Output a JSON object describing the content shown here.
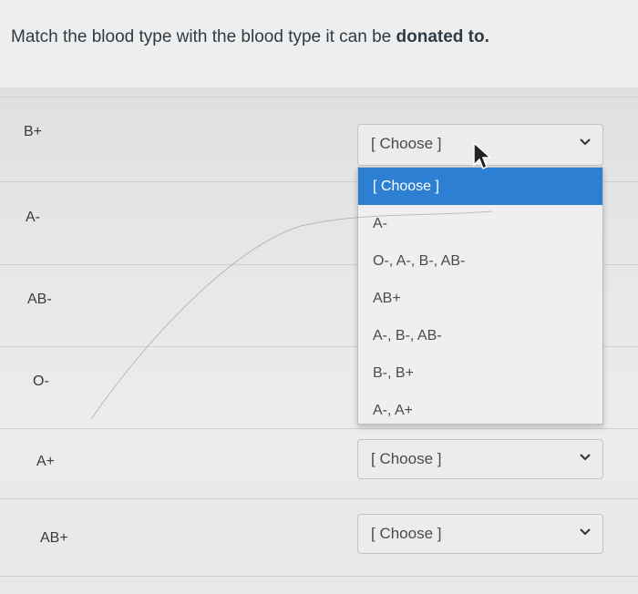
{
  "question": {
    "text_plain": "Match the blood type with the blood type it can be ",
    "text_bold": "donated to."
  },
  "rows": [
    {
      "label": "B+",
      "selected": "[ Choose ]"
    },
    {
      "label": "A-"
    },
    {
      "label": "AB-"
    },
    {
      "label": "O-"
    },
    {
      "label": "A+",
      "selected": "[ Choose ]"
    },
    {
      "label": "AB+",
      "selected": "[ Choose ]"
    }
  ],
  "dropdown": {
    "options": [
      "[ Choose ]",
      "A-",
      "O-, A-, B-, AB-",
      "AB+",
      "A-, B-, AB-",
      "B-, B+",
      "A-, A+"
    ],
    "highlighted_index": 0
  },
  "colors": {
    "highlight": "#2d7fd3",
    "text": "#2d3b45"
  },
  "icons": {
    "select_chevron": "chevron-down-icon",
    "pointer": "mouse-pointer-icon"
  }
}
